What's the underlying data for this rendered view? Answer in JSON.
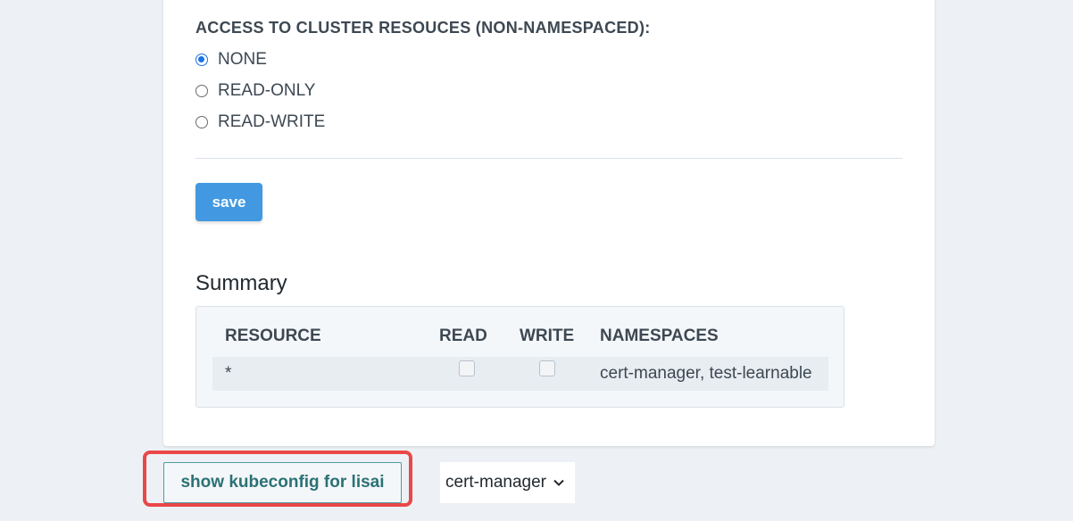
{
  "access": {
    "heading": "ACCESS TO CLUSTER RESOUCES (NON-NAMESPACED):",
    "options": [
      {
        "label": "NONE",
        "checked": true
      },
      {
        "label": "READ-ONLY",
        "checked": false
      },
      {
        "label": "READ-WRITE",
        "checked": false
      }
    ]
  },
  "save_label": "save",
  "summary": {
    "title": "Summary",
    "columns": [
      "RESOURCE",
      "READ",
      "WRITE",
      "NAMESPACES"
    ],
    "rows": [
      {
        "resource": "*",
        "read": false,
        "write": false,
        "namespaces": "cert-manager, test-learnable"
      }
    ]
  },
  "kubeconfig_button": "show kubeconfig for lisai",
  "namespace_select": {
    "value": "cert-manager"
  },
  "colors": {
    "accent_blue": "#4299e1",
    "radio_blue": "#1a73e8",
    "teal": "#2b7175",
    "highlight_red": "#ea4748",
    "page_bg": "#edf1f5"
  },
  "icons": {
    "select_arrow": "chevron-down-icon"
  }
}
